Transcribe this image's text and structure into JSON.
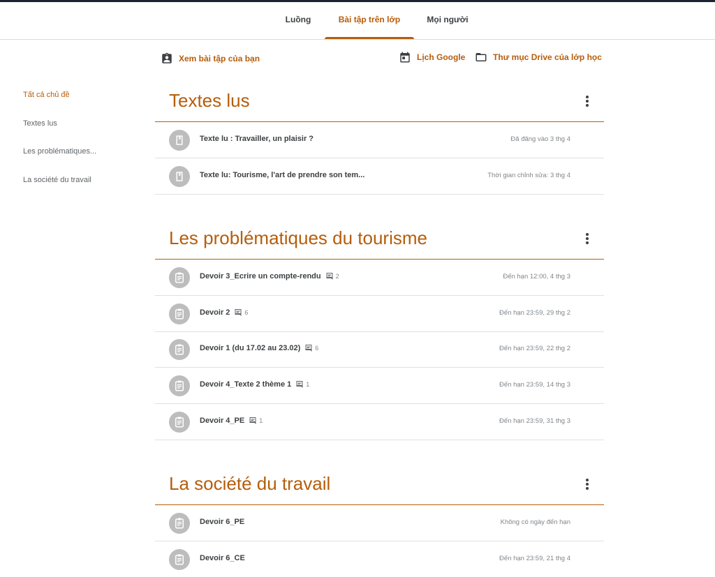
{
  "tabs": [
    {
      "label": "Luồng"
    },
    {
      "label": "Bài tập trên lớp"
    },
    {
      "label": "Mọi người"
    }
  ],
  "actions": {
    "view_work": "Xem bài tập của bạn",
    "calendar": "Lịch Google",
    "drive": "Thư mục Drive của lớp học"
  },
  "sidebar": {
    "items": [
      {
        "label": "Tất cả chủ đề"
      },
      {
        "label": "Textes lus"
      },
      {
        "label": "Les problématiques..."
      },
      {
        "label": "La société du travail"
      }
    ]
  },
  "topics": [
    {
      "title": "Textes lus",
      "items": [
        {
          "title": "Texte lu : Travailler, un plaisir ?",
          "meta": "Đã đăng vào 3 thg 4",
          "icon": "material-icon"
        },
        {
          "title": "Texte lu: Tourisme, l'art de prendre son tem...",
          "meta": "Thời gian chỉnh sửa: 3 thg 4",
          "icon": "material-icon"
        }
      ]
    },
    {
      "title": "Les problématiques du tourisme",
      "items": [
        {
          "title": "Devoir 3_Ecrire un compte-rendu",
          "comments": "2",
          "meta": "Đến hạn 12:00, 4 thg 3",
          "icon": "assignment-icon"
        },
        {
          "title": "Devoir 2",
          "comments": "6",
          "meta": "Đến hạn 23:59, 29 thg 2",
          "icon": "assignment-icon"
        },
        {
          "title": "Devoir 1 (du 17.02 au 23.02)",
          "comments": "6",
          "meta": "Đến hạn 23:59, 22 thg 2",
          "icon": "assignment-icon"
        },
        {
          "title": "Devoir 4_Texte 2 thème 1",
          "comments": "1",
          "meta": "Đến hạn 23:59, 14 thg 3",
          "icon": "assignment-icon"
        },
        {
          "title": "Devoir 4_PE",
          "comments": "1",
          "meta": "Đến hạn 23:59, 31 thg 3",
          "icon": "assignment-icon"
        }
      ]
    },
    {
      "title": "La société du travail",
      "items": [
        {
          "title": "Devoir 6_PE",
          "meta": "Không có ngày đến hạn",
          "icon": "assignment-icon"
        },
        {
          "title": "Devoir 6_CE",
          "meta": "Đến hạn 23:59, 21 thg 4",
          "icon": "assignment-icon"
        }
      ]
    }
  ],
  "colors": {
    "accent": "#b65d0b",
    "icon_bg": "#bdbdbd"
  }
}
